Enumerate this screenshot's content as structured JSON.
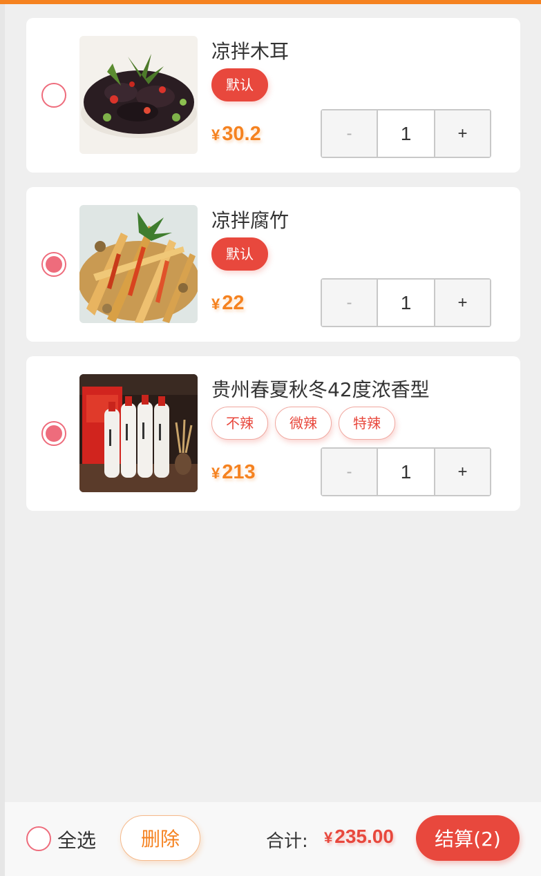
{
  "colors": {
    "accent": "#f58220",
    "primary_red": "#e8483d",
    "radio": "#ee6c7c",
    "background": "#efefef"
  },
  "cart": {
    "items": [
      {
        "title": "凉拌木耳",
        "selected": false,
        "tags": [
          "默认"
        ],
        "currency": "¥",
        "price": "30.2",
        "stepper": {
          "minus": "-",
          "quantity": "1",
          "plus": "+"
        }
      },
      {
        "title": "凉拌腐竹",
        "selected": true,
        "tags": [
          "默认"
        ],
        "currency": "¥",
        "price": "22",
        "stepper": {
          "minus": "-",
          "quantity": "1",
          "plus": "+"
        }
      },
      {
        "title": "贵州春夏秋冬42度浓香型",
        "selected": true,
        "tags": [
          "不辣",
          "微辣",
          "特辣"
        ],
        "currency": "¥",
        "price": "213",
        "stepper": {
          "minus": "-",
          "quantity": "1",
          "plus": "+"
        }
      }
    ]
  },
  "footer": {
    "select_all_label": "全选",
    "select_all_checked": false,
    "delete_label": "删除",
    "total_label": "合计:",
    "total_currency": "¥",
    "total_value": "235.00",
    "checkout_label": "结算(2)"
  }
}
